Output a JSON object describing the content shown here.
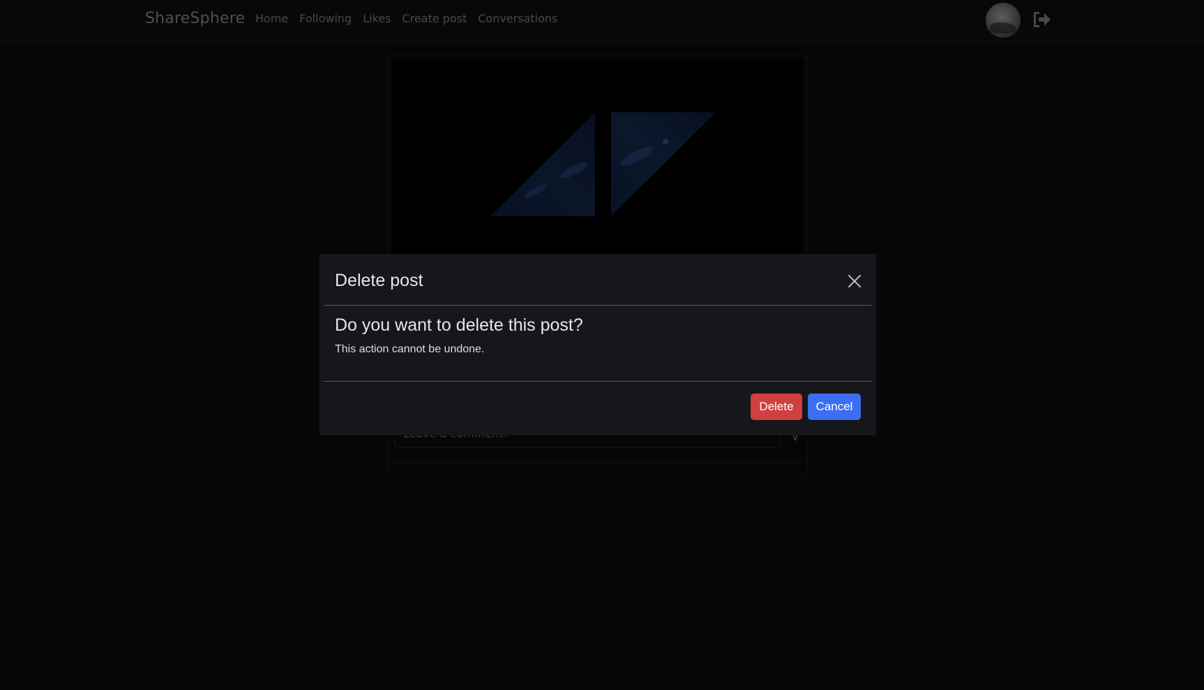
{
  "navbar": {
    "brand": "ShareSphere",
    "links": [
      {
        "label": "Home"
      },
      {
        "label": "Following"
      },
      {
        "label": "Likes"
      },
      {
        "label": "Create post"
      },
      {
        "label": "Conversations"
      }
    ],
    "avatar_icon": "user-avatar",
    "logout_icon": "logout-icon"
  },
  "post": {
    "comment_placeholder": "Leave a comment!",
    "send_icon": "send-icon"
  },
  "modal": {
    "title": "Delete post",
    "question": "Do you want to delete this post?",
    "warning": "This action cannot be undone.",
    "close_icon": "close-icon",
    "delete_label": "Delete",
    "cancel_label": "Cancel"
  },
  "colors": {
    "background": "#0b0c0e",
    "modal_background": "#16171a",
    "delete_button": "#d0403f",
    "cancel_button": "#3b6ef2"
  }
}
